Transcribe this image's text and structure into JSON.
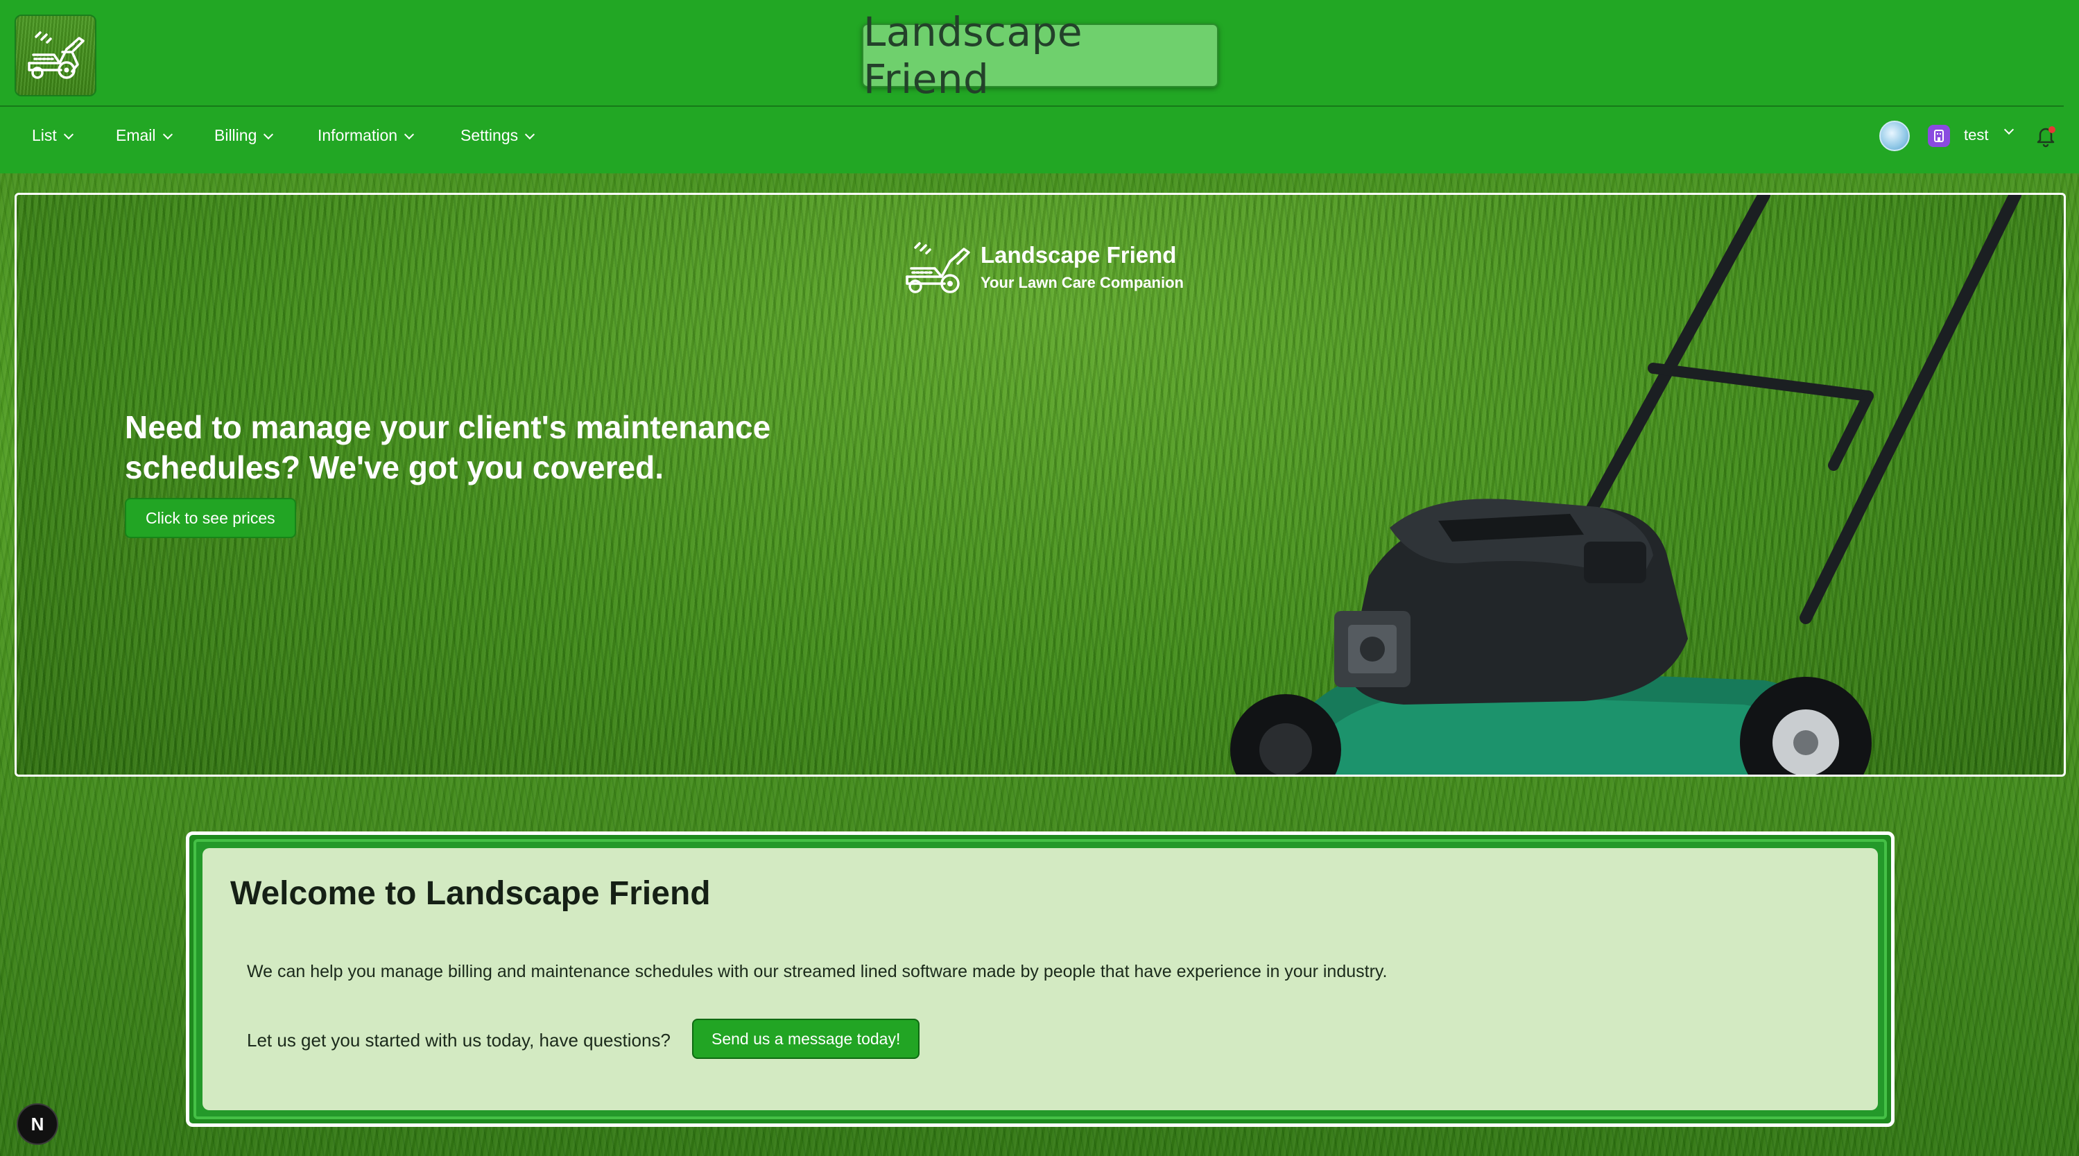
{
  "header": {
    "brand_title": "Landscape Friend",
    "nav": [
      {
        "label": "List"
      },
      {
        "label": "Email"
      },
      {
        "label": "Billing"
      },
      {
        "label": "Information"
      },
      {
        "label": "Settings"
      }
    ],
    "user": {
      "name": "test"
    }
  },
  "hero": {
    "brand_name": "Landscape Friend",
    "tagline": "Your Lawn Care Companion",
    "headline": "Need to manage your client's maintenance schedules? We've got you covered.",
    "cta_label": "Click to see prices"
  },
  "welcome": {
    "title": "Welcome to Landscape Friend",
    "description": "We can help you manage billing and maintenance schedules with our streamed lined software made by people that have experience in your industry.",
    "cta_text": "Let us get you started with us today, have questions?",
    "cta_button": "Send us a message today!"
  },
  "dev_badge": {
    "letter": "N"
  },
  "icons": {
    "logo": "lawn-mower-icon",
    "globe": "globe-avatar-icon",
    "org": "organization-icon",
    "bell": "bell-icon",
    "chevron": "chevron-down-icon"
  },
  "colors": {
    "header_bg": "#22a724",
    "button_bg": "#22a524",
    "title_box_bg": "#6fd06d",
    "card_bg": "#e1f0cd",
    "org_icon": "#8a4be0",
    "notification_dot": "#e53935"
  }
}
